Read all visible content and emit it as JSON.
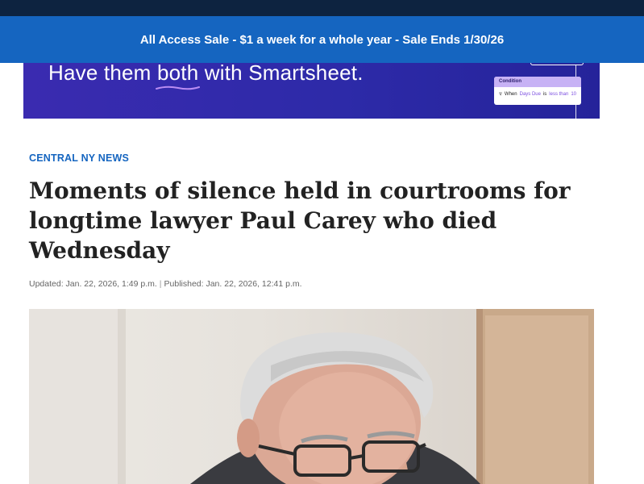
{
  "sale_banner": {
    "text": "All Access Sale - $1 a week for a whole year - Sale Ends 1/30/26"
  },
  "ad": {
    "headline_prefix": "Have them ",
    "headline_emphasis": "both",
    "headline_suffix": " with Smartsheet.",
    "card": {
      "header": "Condition",
      "when": "When",
      "field": "Days Due",
      "is": "is",
      "operator": "less than",
      "value": "10"
    },
    "colors": {
      "background": "#2d2aa8",
      "card_header": "#c7b2f5",
      "highlight": "#7b4ee0"
    }
  },
  "article": {
    "category": "CENTRAL NY NEWS",
    "title": "Moments of silence held in courtrooms for longtime lawyer Paul Carey who died Wednesday",
    "updated": "Updated: Jan. 22, 2026, 1:49 p.m.",
    "separator": "|",
    "published": "Published: Jan. 22, 2026, 12:41 p.m."
  },
  "colors": {
    "topbar": "#0d2340",
    "banner": "#1565c0",
    "category": "#1565c0",
    "title": "#222222"
  }
}
